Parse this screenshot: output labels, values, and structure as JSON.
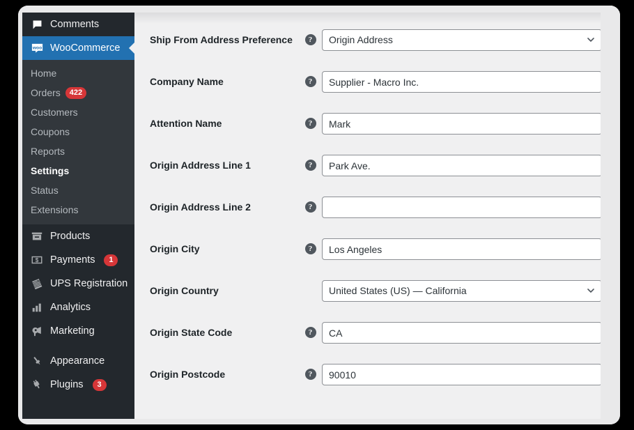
{
  "sidebar": {
    "menu": [
      {
        "label": "Comments",
        "icon": "comment-icon",
        "name": "sidebar-item-comments",
        "current": false,
        "badge": null
      },
      {
        "label": "WooCommerce",
        "icon": "woocommerce-icon",
        "name": "sidebar-item-woocommerce",
        "current": true,
        "badge": null
      }
    ],
    "submenu": [
      {
        "label": "Home",
        "name": "submenu-item-home",
        "current": false,
        "badge": null
      },
      {
        "label": "Orders",
        "name": "submenu-item-orders",
        "current": false,
        "badge": "422"
      },
      {
        "label": "Customers",
        "name": "submenu-item-customers",
        "current": false,
        "badge": null
      },
      {
        "label": "Coupons",
        "name": "submenu-item-coupons",
        "current": false,
        "badge": null
      },
      {
        "label": "Reports",
        "name": "submenu-item-reports",
        "current": false,
        "badge": null
      },
      {
        "label": "Settings",
        "name": "submenu-item-settings",
        "current": true,
        "badge": null
      },
      {
        "label": "Status",
        "name": "submenu-item-status",
        "current": false,
        "badge": null
      },
      {
        "label": "Extensions",
        "name": "submenu-item-extensions",
        "current": false,
        "badge": null
      }
    ],
    "menu_lower": [
      {
        "label": "Products",
        "icon": "products-box-icon",
        "name": "sidebar-item-products",
        "badge": null,
        "gap_before": false
      },
      {
        "label": "Payments",
        "icon": "payments-dollar-icon",
        "name": "sidebar-item-payments",
        "badge": "1",
        "gap_before": false
      },
      {
        "label": "UPS Registration",
        "icon": "ups-package-icon",
        "name": "sidebar-item-ups-registration",
        "badge": null,
        "gap_before": false
      },
      {
        "label": "Analytics",
        "icon": "analytics-bars-icon",
        "name": "sidebar-item-analytics",
        "badge": null,
        "gap_before": false
      },
      {
        "label": "Marketing",
        "icon": "megaphone-icon",
        "name": "sidebar-item-marketing",
        "badge": null,
        "gap_before": false
      },
      {
        "label": "Appearance",
        "icon": "paintbrush-icon",
        "name": "sidebar-item-appearance",
        "badge": null,
        "gap_before": true
      },
      {
        "label": "Plugins",
        "icon": "plug-icon",
        "name": "sidebar-item-plugins",
        "badge": "3",
        "gap_before": false
      }
    ],
    "colors": {
      "background": "#23282d",
      "submenu_background": "#32373c",
      "current_background": "#2271b1",
      "badge_background": "#d63638",
      "text": "#b4b9be"
    }
  },
  "form": {
    "fields": [
      {
        "label": "Ship From Address Preference",
        "name": "ship-from-address-preference",
        "type": "select",
        "value": "Origin Address",
        "has_help": true,
        "two_line": true
      },
      {
        "label": "Company Name",
        "name": "company-name",
        "type": "text",
        "value": "Supplier - Macro Inc.",
        "has_help": true,
        "two_line": false
      },
      {
        "label": "Attention Name",
        "name": "attention-name",
        "type": "text",
        "value": "Mark",
        "has_help": true,
        "two_line": false
      },
      {
        "label": "Origin Address Line 1",
        "name": "origin-address-line-1",
        "type": "text",
        "value": "Park Ave.",
        "has_help": true,
        "two_line": false
      },
      {
        "label": "Origin Address Line 2",
        "name": "origin-address-line-2",
        "type": "text",
        "value": "",
        "has_help": true,
        "two_line": false
      },
      {
        "label": "Origin City",
        "name": "origin-city",
        "type": "text",
        "value": "Los Angeles",
        "has_help": true,
        "two_line": false
      },
      {
        "label": "Origin Country",
        "name": "origin-country",
        "type": "select",
        "value": "United States (US) — California",
        "has_help": false,
        "two_line": false
      },
      {
        "label": "Origin State Code",
        "name": "origin-state-code",
        "type": "text",
        "value": "CA",
        "has_help": true,
        "two_line": false
      },
      {
        "label": "Origin Postcode",
        "name": "origin-postcode",
        "type": "text",
        "value": "90010",
        "has_help": true,
        "two_line": false
      }
    ],
    "help_glyph": "?"
  }
}
